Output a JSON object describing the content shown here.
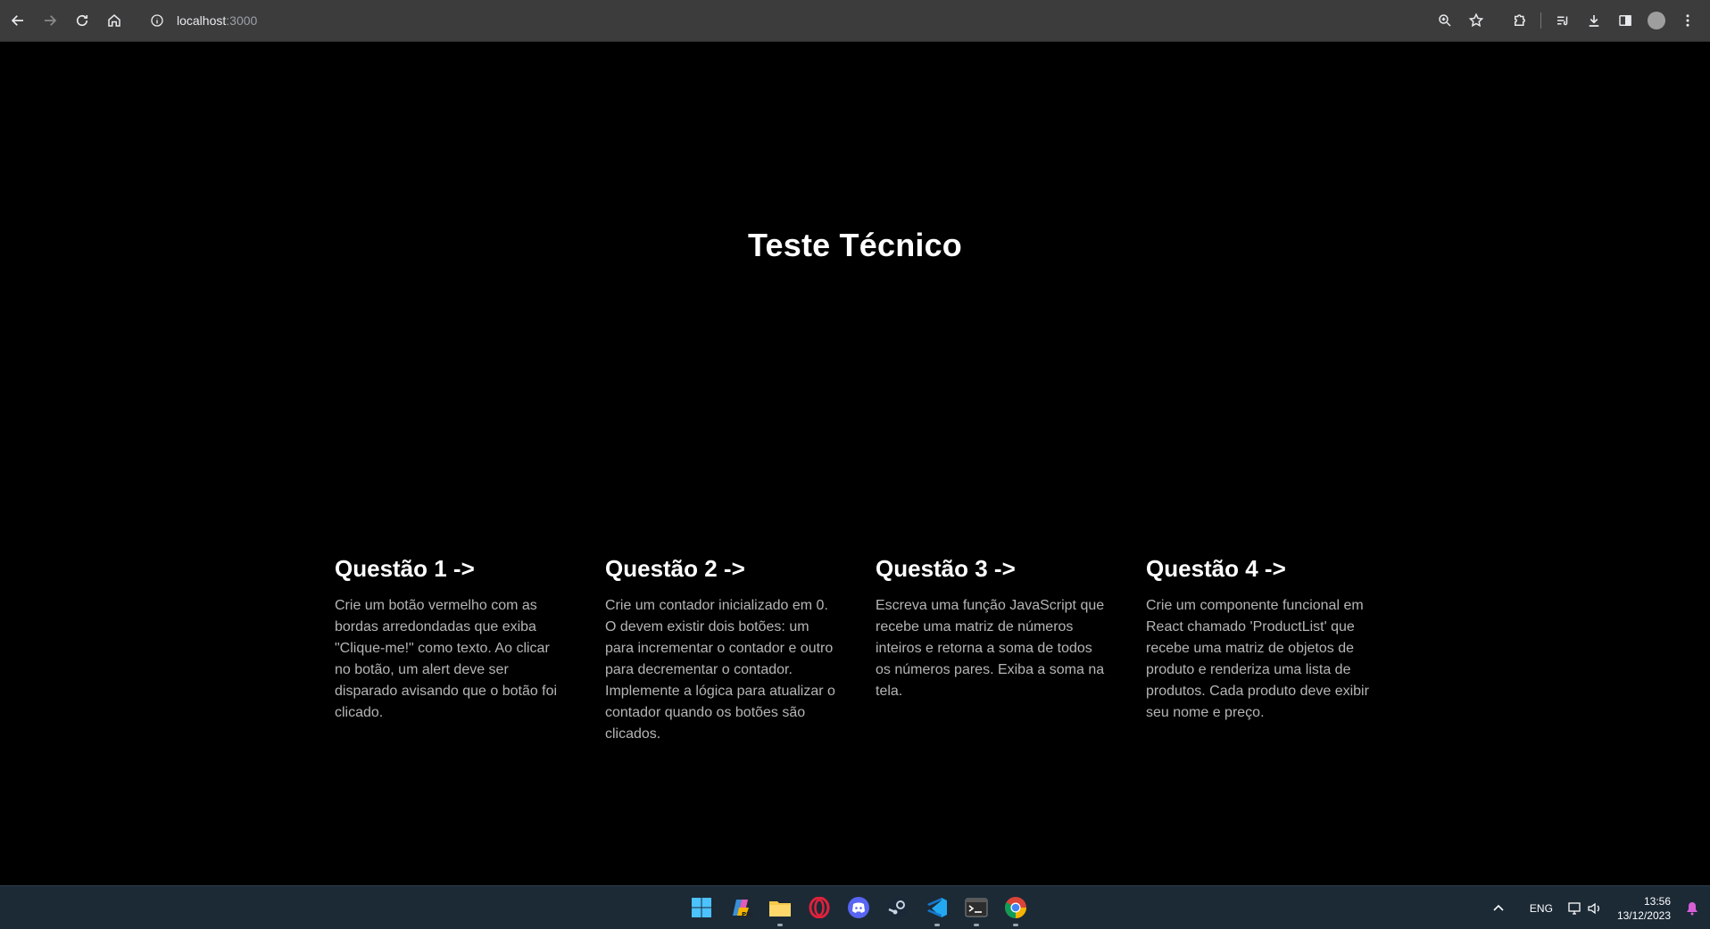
{
  "browser": {
    "url_host": "localhost",
    "url_port": ":3000",
    "icons": [
      "back-icon",
      "forward-icon",
      "reload-icon",
      "home-icon",
      "info-icon",
      "zoom-icon",
      "star-icon",
      "extensions-icon",
      "media-icon",
      "download-icon",
      "sidepanel-icon",
      "profile-avatar",
      "menu-icon"
    ]
  },
  "page": {
    "title": "Teste Técnico",
    "cards": [
      {
        "heading": "Questão 1 ->",
        "body": "Crie um botão vermelho com as bordas arredondadas que exiba \"Clique-me!\" como texto. Ao clicar no botão, um alert deve ser disparado avisando que o botão foi clicado."
      },
      {
        "heading": "Questão 2 ->",
        "body": "Crie um contador inicializado em 0. O devem existir dois botões: um para incrementar o contador e outro para decrementar o contador. Implemente a lógica para atualizar o contador quando os botões são clicados."
      },
      {
        "heading": "Questão 3 ->",
        "body": "Escreva uma função JavaScript que recebe uma matriz de números inteiros e retorna a soma de todos os números pares. Exiba a soma na tela."
      },
      {
        "heading": "Questão 4 ->",
        "body": "Crie um componente funcional em React chamado 'ProductList' que recebe uma matriz de objetos de produto e renderiza uma lista de produtos. Cada produto deve exibir seu nome e preço."
      }
    ]
  },
  "taskbar": {
    "apps": [
      "windows-start-icon",
      "copilot-icon",
      "file-explorer-icon",
      "opera-icon",
      "discord-icon",
      "steam-icon",
      "vscode-icon",
      "terminal-icon",
      "chrome-icon"
    ],
    "tray": {
      "language": "ENG",
      "time": "13:56",
      "date": "13/12/2023"
    },
    "colors": {
      "background": "#1c2a36",
      "accent": "#0078d4"
    }
  }
}
